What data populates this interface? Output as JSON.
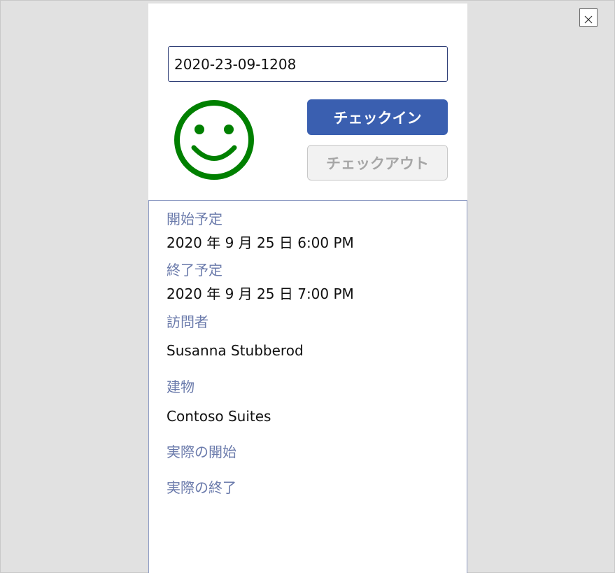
{
  "window": {
    "close_icon": "close-icon"
  },
  "checkin": {
    "code_value": "2020-23-09-1208",
    "status_icon": "smiley-face-icon",
    "status_color": "#008000",
    "checkin_label": "チェックイン",
    "checkout_label": "チェックアウト",
    "checkin_enabled": true,
    "checkout_enabled": false,
    "accent_color": "#3a5fb0"
  },
  "details": {
    "start_label": "開始予定",
    "start_value": "2020 年 9 月 25 日 6:00 PM",
    "end_label": "終了予定",
    "end_value": "2020 年 9 月 25 日 7:00 PM",
    "visitor_label": "訪問者",
    "visitor_value": "Susanna Stubberod",
    "building_label": "建物",
    "building_value": "Contoso Suites",
    "actual_start_label": "実際の開始",
    "actual_end_label": "実際の終了"
  }
}
